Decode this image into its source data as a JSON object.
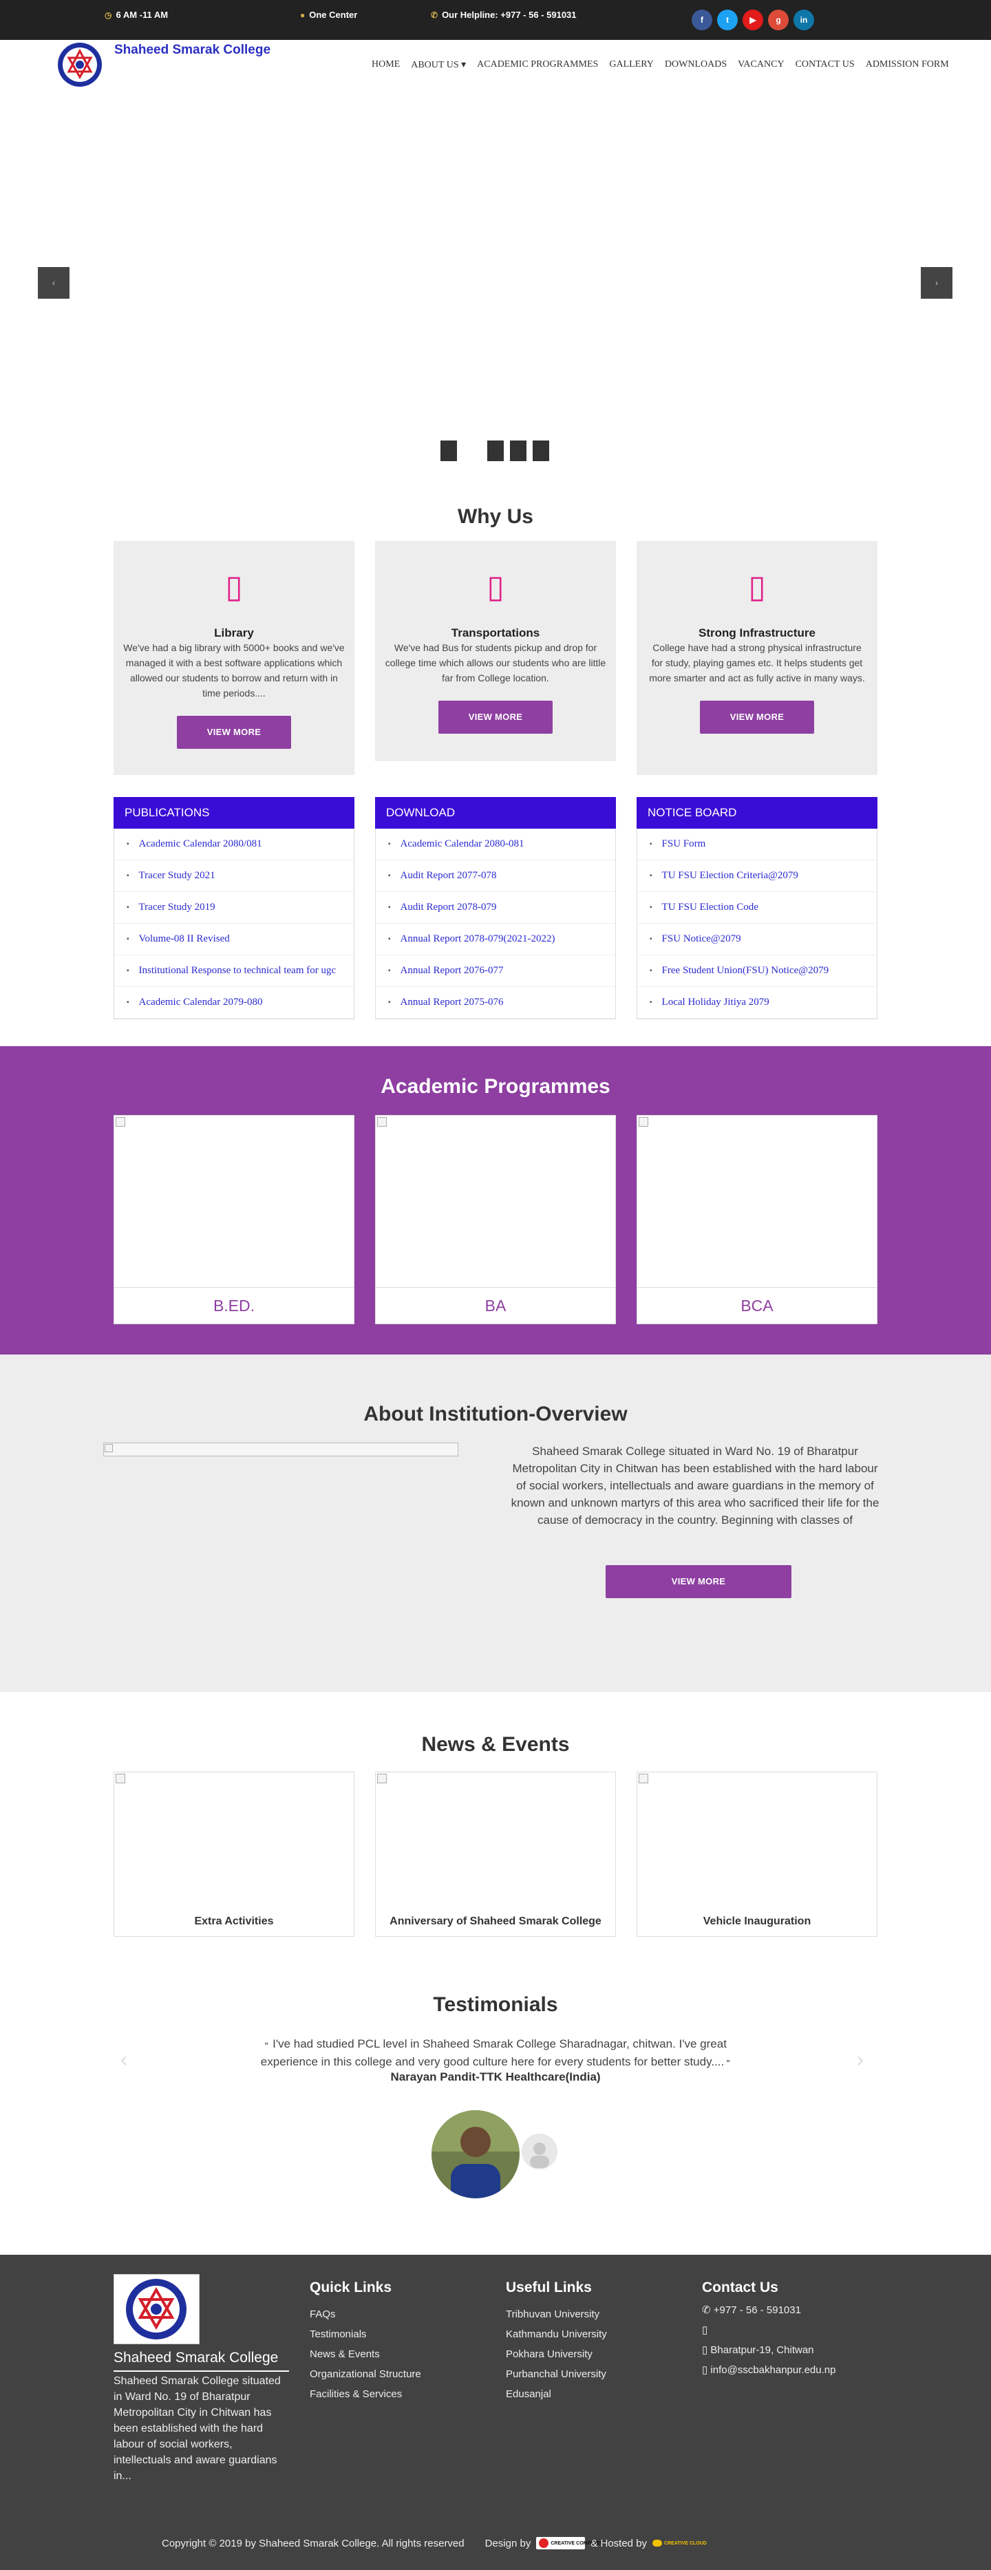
{
  "topbar": {
    "hours": "6 AM -11 AM",
    "center": "One Center",
    "helpline": "Our Helpline: +977 - 56 - 591031",
    "social": [
      {
        "icon": "facebook-icon",
        "glyph": "f",
        "color": "#3b5998"
      },
      {
        "icon": "twitter-icon",
        "glyph": "t",
        "color": "#1da1f2"
      },
      {
        "icon": "youtube-icon",
        "glyph": "▶",
        "color": "#e21b1b"
      },
      {
        "icon": "google-plus-icon",
        "glyph": "g",
        "color": "#dd4b39"
      },
      {
        "icon": "linkedin-icon",
        "glyph": "in",
        "color": "#0e76a8"
      }
    ]
  },
  "brand": {
    "name": "Shaheed Smarak College"
  },
  "nav": {
    "items": [
      "HOME",
      "ABOUT US ▾",
      "ACADEMIC PROGRAMMES",
      "GALLERY",
      "DOWNLOADS",
      "VACANCY",
      "CONTACT US",
      "ADMISSION FORM"
    ]
  },
  "slider": {
    "prev": "‹",
    "next": "›"
  },
  "why": {
    "title": "Why Us",
    "cards": [
      {
        "icon": "library-icon",
        "glyph": "▯",
        "title": "Library",
        "text": "We've had a big library with 5000+ books and we've managed it with a best software applications which allowed our students to borrow and return with in time periods....",
        "button": "VIEW MORE"
      },
      {
        "icon": "bus-icon",
        "glyph": "▯",
        "title": "Transportations",
        "text": "We've had Bus for students pickup and drop for college time which allows our students who are little far from College location.",
        "button": "VIEW MORE"
      },
      {
        "icon": "building-icon",
        "glyph": "▯",
        "title": "Strong Infrastructure",
        "text": "College have had a strong physical infrastructure for study, playing games etc. It helps students get more smarter and act as fully active in many ways.",
        "button": "VIEW MORE"
      }
    ]
  },
  "lists": [
    {
      "title": "PUBLICATIONS",
      "items": [
        "Academic Calendar 2080/081",
        "Tracer Study 2021",
        "Tracer Study 2019",
        "Volume-08 II Revised",
        "Institutional Response to technical team for ugc",
        "Academic Calendar 2079-080"
      ]
    },
    {
      "title": "DOWNLOAD",
      "items": [
        "Academic Calendar 2080-081",
        "Audit Report 2077-078",
        "Audit Report 2078-079",
        "Annual Report 2078-079(2021-2022)",
        "Annual Report 2076-077",
        "Annual Report 2075-076"
      ]
    },
    {
      "title": "NOTICE BOARD",
      "items": [
        "FSU Form",
        "TU FSU Election Criteria@2079",
        "TU FSU Election Code",
        "FSU Notice@2079",
        "Free Student Union(FSU) Notice@2079",
        "Local Holiday Jitiya 2079"
      ]
    }
  ],
  "programmes": {
    "title": "Academic Programmes",
    "items": [
      "B.ED.",
      "BA",
      "BCA"
    ]
  },
  "about": {
    "title": "About Institution-Overview",
    "text": "Shaheed Smarak College situated in Ward No. 19 of Bharatpur Metropolitan City in Chitwan has been established with the hard labour of social workers, intellectuals and aware guardians in the memory of known and unknown martyrs of this area who sacrificed their life for the cause of democracy in the country. Beginning with classes of",
    "button": "VIEW MORE"
  },
  "news": {
    "title": "News & Events",
    "items": [
      "Extra Activities",
      "Anniversary of Shaheed Smarak College",
      "Vehicle Inauguration"
    ]
  },
  "testimonials": {
    "title": "Testimonials",
    "quote": "I've had studied PCL level in Shaheed Smarak College Sharadnagar, chitwan. I've great experience in this college and very good culture here for every students for better study....",
    "author": "Narayan Pandit-TTK Healthcare(India)"
  },
  "footer": {
    "college": {
      "name": "Shaheed Smarak College",
      "text": "Shaheed Smarak College situated in Ward No. 19 of Bharatpur Metropolitan City in Chitwan has been established with the hard labour of social workers, intellectuals and aware guardians in..."
    },
    "quick": {
      "title": "Quick Links",
      "items": [
        "FAQs",
        "Testimonials",
        "News & Events",
        "Organizational Structure",
        "Facilities & Services"
      ]
    },
    "useful": {
      "title": "Useful Links",
      "items": [
        "Tribhuvan University",
        "Kathmandu University",
        "Pokhara University",
        "Purbanchal University",
        "Edusanjal"
      ]
    },
    "contact": {
      "title": "Contact Us",
      "phone": "+977 - 56 - 591031",
      "blank": "",
      "address": "Bharatpur-19, Chitwan",
      "email": "info@sscbakhanpur.edu.np"
    },
    "copyright": "Copyright © 2019 by Shaheed Smarak College. All rights reserved",
    "design": "Design by",
    "hosted": "& Hosted by",
    "design_logo": "CREATIVE COMPUTERS",
    "host_logo": "CREATIVE CLOUD"
  }
}
